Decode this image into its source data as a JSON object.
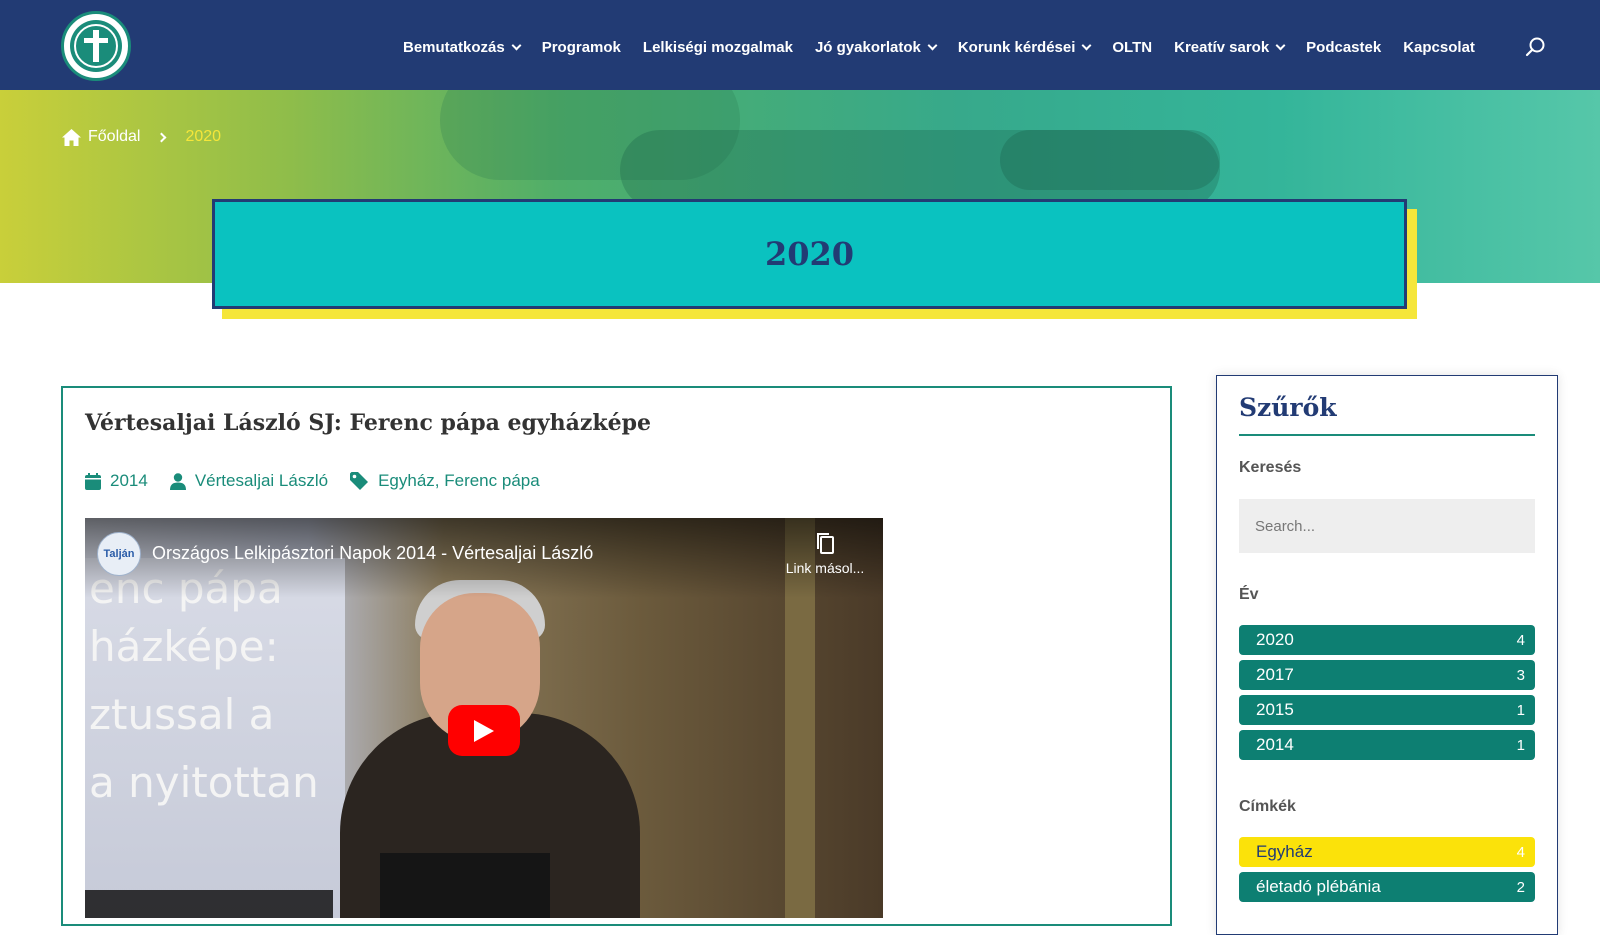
{
  "header": {
    "nav": [
      {
        "label": "Bemutatkozás",
        "dropdown": true
      },
      {
        "label": "Programok",
        "dropdown": false
      },
      {
        "label": "Lelkiségi mozgalmak",
        "dropdown": false
      },
      {
        "label": "Jó gyakorlatok",
        "dropdown": true
      },
      {
        "label": "Korunk kérdései",
        "dropdown": true
      },
      {
        "label": "OLTN",
        "dropdown": false
      },
      {
        "label": "Kreatív sarok",
        "dropdown": true
      },
      {
        "label": "Podcastek",
        "dropdown": false
      },
      {
        "label": "Kapcsolat",
        "dropdown": false
      }
    ]
  },
  "breadcrumb": {
    "home": "Főoldal",
    "current": "2020"
  },
  "page_title": "2020",
  "article": {
    "title": "Vértesaljai László SJ: Ferenc pápa egyházképe",
    "year": "2014",
    "author": "Vértesaljai László",
    "tags": "Egyház, Ferenc pápa",
    "video": {
      "title": "Országos Lelkipásztori Napok 2014 - Vértesaljai László",
      "copy_label": "Link másol...",
      "channel_badge": "Talján",
      "slide_lines": [
        "enc pápa",
        "házképe:",
        "ztussal a",
        "a nyitottan"
      ]
    }
  },
  "sidebar": {
    "title": "Szűrők",
    "search_label": "Keresés",
    "search_placeholder": "Search...",
    "year_label": "Év",
    "years": [
      {
        "label": "2020",
        "count": "4"
      },
      {
        "label": "2017",
        "count": "3"
      },
      {
        "label": "2015",
        "count": "1"
      },
      {
        "label": "2014",
        "count": "1"
      }
    ],
    "tags_label": "Címkék",
    "tags": [
      {
        "label": "Egyház",
        "count": "4",
        "highlight": true
      },
      {
        "label": "életadó plébánia",
        "count": "2",
        "highlight": false
      }
    ]
  },
  "colors": {
    "navy": "#223b74",
    "teal": "#0d7f72",
    "cyan": "#0ac2c0",
    "yellow": "#f5e63a"
  }
}
